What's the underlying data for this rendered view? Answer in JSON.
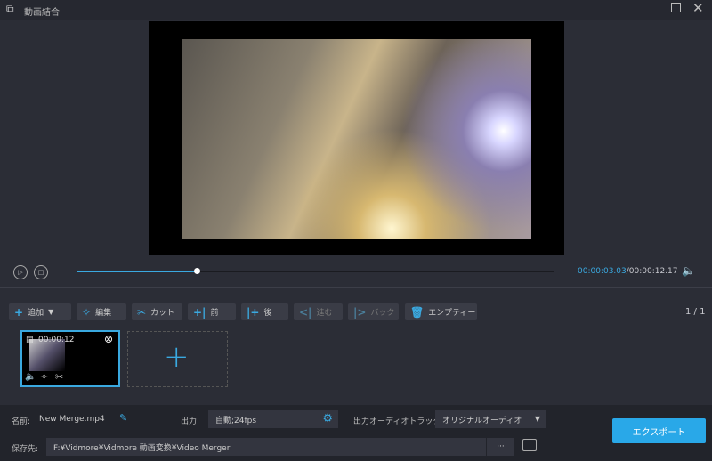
{
  "window": {
    "title": "動画結合",
    "app_icon": "merge-icon"
  },
  "player": {
    "current_time": "00:00:03.03",
    "total_time": "/00:00:12.17",
    "progress": 0.25
  },
  "toolbar": {
    "add": "追加",
    "edit": "編集",
    "cut": "カット",
    "front": "前",
    "back": "後",
    "forward": "進む",
    "backward": "バック",
    "empty": "エンプティー",
    "page": "1 / 1"
  },
  "clip": {
    "duration": "00:00:12"
  },
  "bottom": {
    "name_label": "名前:",
    "name_value": "New Merge.mp4",
    "output_label": "出力:",
    "output_value": "自動;24fps",
    "audio_label": "出力オーディオトラック:",
    "audio_value": "オリジナルオーディオ",
    "save_label": "保存先:",
    "save_path": "F:¥Vidmore¥Vidmore 動画変換¥Video Merger",
    "browse": "···",
    "export": "エクスポート"
  },
  "colors": {
    "accent": "#3aa9e0",
    "export": "#29a8e8"
  }
}
